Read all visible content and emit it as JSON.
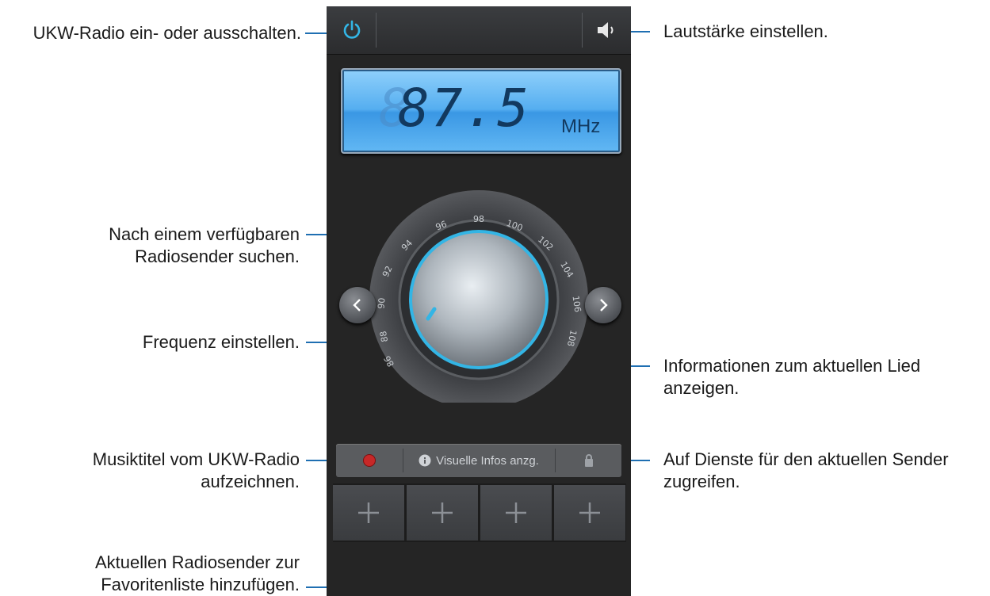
{
  "callouts": {
    "power": "UKW-Radio ein- oder ausschalten.",
    "volume": "Lautstärke einstellen.",
    "search": [
      "Nach einem verfügbaren",
      "Radiosender suchen."
    ],
    "tune": "Frequenz einstellen.",
    "song_info": [
      "Informationen zum aktuellen Lied",
      "anzeigen."
    ],
    "record": [
      "Musiktitel vom UKW-Radio",
      "aufzeichnen."
    ],
    "services": [
      "Auf Dienste für den aktuellen Sender",
      "zugreifen."
    ],
    "favorites": [
      "Aktuellen Radiosender zur",
      "Favoritenliste hinzufügen."
    ]
  },
  "radio": {
    "frequency": "87.5",
    "unit": "MHz",
    "dial_labels": [
      "88",
      "90",
      "92",
      "94",
      "96",
      "98",
      "100",
      "102",
      "104",
      "106",
      "108",
      "86"
    ],
    "info_button": "Visuelle Infos anzg.",
    "favorites_add": [
      "+",
      "+",
      "+",
      "+"
    ]
  },
  "icons": {
    "power": "power-icon",
    "volume": "speaker-icon",
    "prev": "chevron-left-icon",
    "next": "chevron-right-icon",
    "record": "record-icon",
    "info": "info-icon",
    "lock": "lock-icon"
  },
  "colors": {
    "accent": "#33b5e5",
    "display_blue": "#4aa8ee",
    "record_red": "#c62828",
    "leader_line": "#1f6fb2"
  }
}
